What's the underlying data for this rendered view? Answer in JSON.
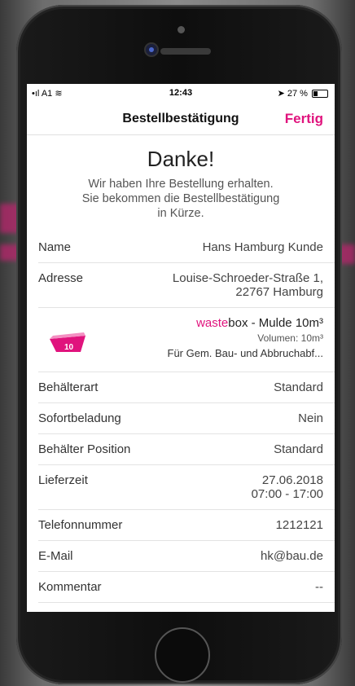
{
  "status_bar": {
    "carrier": "A1",
    "time": "12:43",
    "battery": "27 %"
  },
  "nav": {
    "title": "Bestellbestätigung",
    "done": "Fertig"
  },
  "thanks": {
    "heading": "Danke!",
    "message_line1": "Wir haben Ihre Bestellung erhalten.",
    "message_line2": "Sie bekommen die Bestellbestätigung",
    "message_line3": "in Kürze."
  },
  "name_row": {
    "label": "Name",
    "value": "Hans Hamburg Kunde"
  },
  "address_row": {
    "label": "Adresse",
    "line1": "Louise-Schroeder-Straße 1,",
    "line2": "22767 Hamburg"
  },
  "product": {
    "brand": "waste",
    "name_rest": "box - Mulde 10m³",
    "volume": "Volumen: 10m³",
    "description": "Für Gem. Bau- und Abbruchabf...",
    "icon_number": "10",
    "icon": "container-icon"
  },
  "details": [
    {
      "label": "Behälterart",
      "value": "Standard"
    },
    {
      "label": "Sofortbeladung",
      "value": "Nein"
    },
    {
      "label": "Behälter Position",
      "value": "Standard"
    }
  ],
  "delivery": {
    "label": "Lieferzeit",
    "date": "27.06.2018",
    "time": "07:00 - 17:00"
  },
  "contact": [
    {
      "label": "Telefonnummer",
      "value": "1212121"
    },
    {
      "label": "E-Mail",
      "value": "hk@bau.de"
    },
    {
      "label": "Kommentar",
      "value": "--"
    }
  ],
  "colors": {
    "accent": "#e0137d"
  }
}
